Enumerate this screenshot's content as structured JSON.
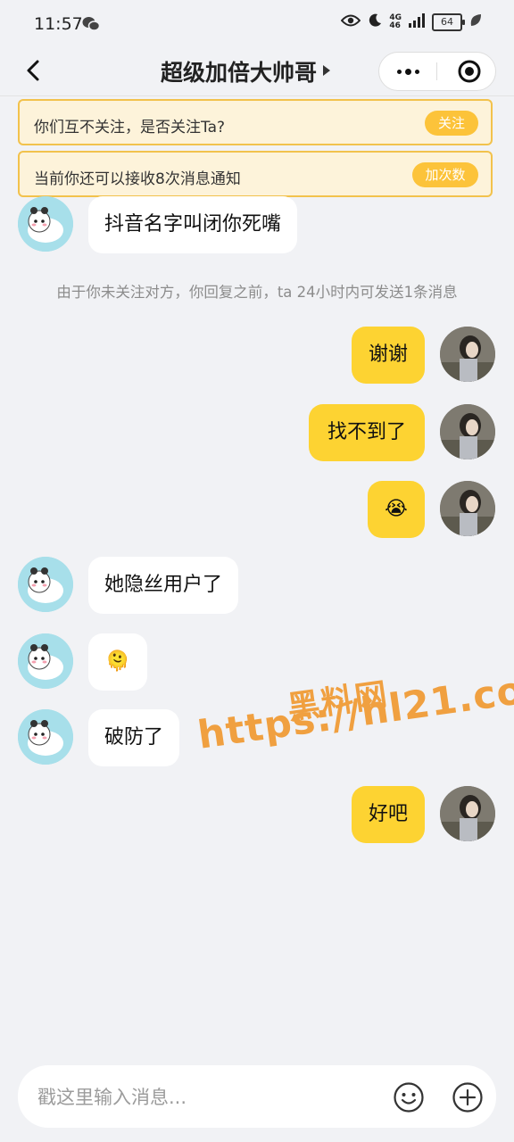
{
  "status_bar": {
    "time": "11:57",
    "network_top": "4G",
    "network_bottom": "46",
    "battery": "64"
  },
  "nav": {
    "title": "超级加倍大帅哥"
  },
  "banners": {
    "follow": {
      "text": "你们互不关注，是否关注Ta?",
      "button": "关注"
    },
    "notify": {
      "text": "当前你还可以接收8次消息通知",
      "button": "加次数"
    }
  },
  "messages": {
    "m1": "抖音名字叫闭你死嘴",
    "system_note": "由于你未关注对方，你回复之前，ta 24小时内可发送1条消息",
    "m2": "谢谢",
    "m3": "找不到了",
    "m4_emoji": "😭",
    "m5": "她隐丝用户了",
    "m6_emoji": "🫠",
    "m7": "破防了",
    "m8": "好吧"
  },
  "watermark": {
    "line1": "黑料网",
    "line2": "https://hl21.co"
  },
  "input": {
    "placeholder": "戳这里输入消息..."
  },
  "colors": {
    "accent_yellow": "#fdd332",
    "banner_bg": "#fdf3da",
    "banner_border": "#f2c24c",
    "banner_button": "#fcc33a",
    "page_bg": "#f1f2f5",
    "watermark": "#f0a040"
  }
}
